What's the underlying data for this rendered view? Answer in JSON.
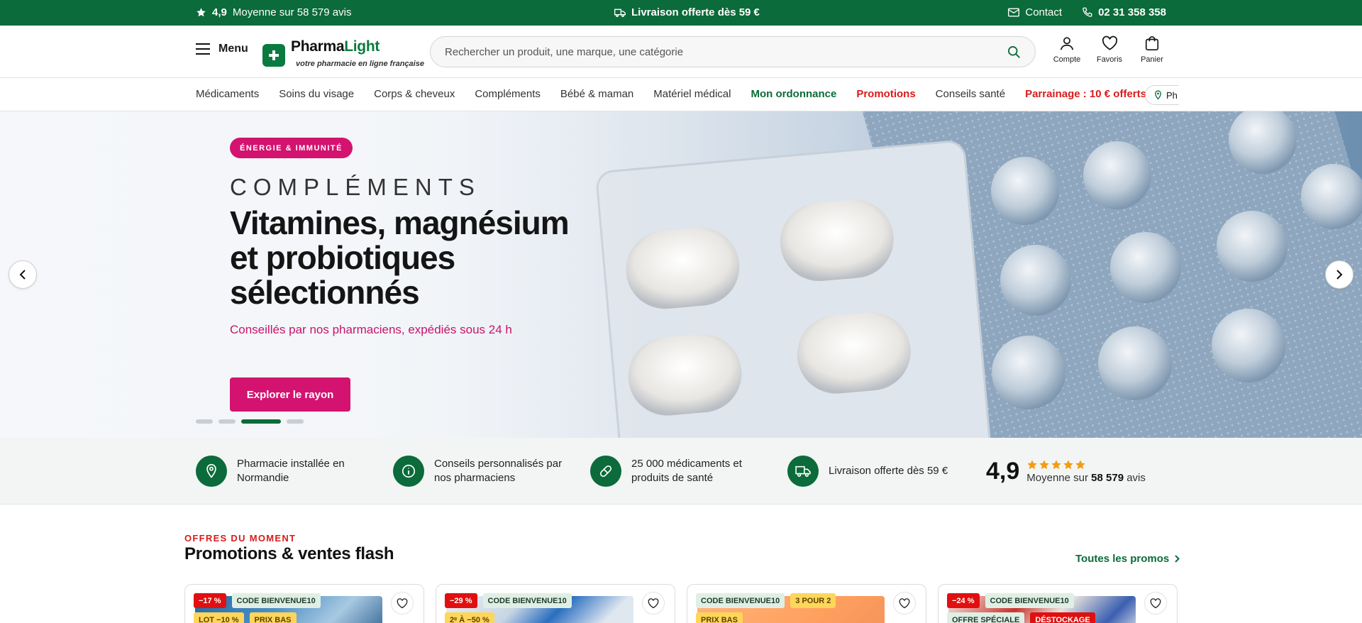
{
  "topbar": {
    "rating_value": "4,9",
    "rating_text": "Moyenne sur 58 579 avis",
    "shipping": "Livraison offerte dès 59 €",
    "contact": "Contact",
    "phone": "02 31 358 358"
  },
  "header": {
    "menu_label": "Menu",
    "logo_name_part1": "Pharma",
    "logo_name_part2": "Light",
    "logo_tagline": "votre pharmacie en ligne française",
    "search_placeholder": "Rechercher un produit, une marque, une catégorie",
    "actions": [
      {
        "label": "Compte",
        "icon": "user-icon"
      },
      {
        "label": "Favoris",
        "icon": "heart-icon"
      },
      {
        "label": "Panier",
        "icon": "bag-icon"
      }
    ]
  },
  "nav": {
    "items": [
      {
        "label": "Médicaments",
        "style": "normal"
      },
      {
        "label": "Soins du visage",
        "style": "normal"
      },
      {
        "label": "Corps & cheveux",
        "style": "normal"
      },
      {
        "label": "Compléments",
        "style": "normal"
      },
      {
        "label": "Bébé & maman",
        "style": "normal"
      },
      {
        "label": "Matériel médical",
        "style": "normal"
      },
      {
        "label": "Mon ordonnance",
        "style": "green"
      },
      {
        "label": "Promotions",
        "style": "red"
      },
      {
        "label": "Conseils santé",
        "style": "normal"
      },
      {
        "label": "Parrainage : 10 € offerts",
        "style": "red"
      }
    ],
    "pharmacy_chip": "Ph"
  },
  "hero": {
    "badge": "ÉNERGIE & IMMUNITÉ",
    "kicker": "COMPLÉMENTS",
    "title": "Vitamines, magnésium et probiotiques sélectionnés",
    "subtitle": "Conseillés par nos pharmaciens, expédiés sous 24 h",
    "cta": "Explorer le rayon",
    "slide_count": 4,
    "active_slide": 3,
    "prev_icon": "chevron-left-icon",
    "next_icon": "chevron-right-icon"
  },
  "reassurance": {
    "items": [
      {
        "icon": "map-pin-icon",
        "text": "Pharmacie installée en Normandie"
      },
      {
        "icon": "info-icon",
        "text": "Conseils personnalisés par nos pharmaciens"
      },
      {
        "icon": "pill-icon",
        "text": "25 000 médicaments et produits de santé"
      },
      {
        "icon": "truck-icon",
        "text": "Livraison offerte dès 59 €"
      }
    ],
    "rating_value": "4,9",
    "rating_prefix": "Moyenne sur",
    "rating_count": "58 579",
    "rating_suffix": "avis",
    "stars": 5
  },
  "promos": {
    "eyebrow": "OFFRES DU MOMENT",
    "title": "Promotions & ventes flash",
    "see_all": "Toutes les promos",
    "cards": [
      {
        "tags": [
          {
            "text": "−17 %",
            "style": "red"
          },
          {
            "text": "CODE BIENVENUE10",
            "style": "green"
          },
          {
            "text": "LOT −10 %",
            "style": "yellow"
          },
          {
            "text": "PRIX BAS",
            "style": "yellow"
          }
        ]
      },
      {
        "tags": [
          {
            "text": "−29 %",
            "style": "red"
          },
          {
            "text": "CODE BIENVENUE10",
            "style": "green"
          },
          {
            "text": "2ᵉ À −50 %",
            "style": "yellow"
          }
        ]
      },
      {
        "tags": [
          {
            "text": "CODE BIENVENUE10",
            "style": "green"
          },
          {
            "text": "3 POUR 2",
            "style": "yellow"
          },
          {
            "text": "PRIX BAS",
            "style": "yellow"
          }
        ]
      },
      {
        "tags": [
          {
            "text": "−24 %",
            "style": "red"
          },
          {
            "text": "CODE BIENVENUE10",
            "style": "green"
          },
          {
            "text": "OFFRE SPÉCIALE",
            "style": "green"
          },
          {
            "text": "DÉSTOCKAGE",
            "style": "red"
          }
        ]
      }
    ]
  },
  "colors": {
    "brand_green": "#0b6b3a",
    "accent_pink": "#d3136f",
    "promo_red": "#d81b1b"
  }
}
